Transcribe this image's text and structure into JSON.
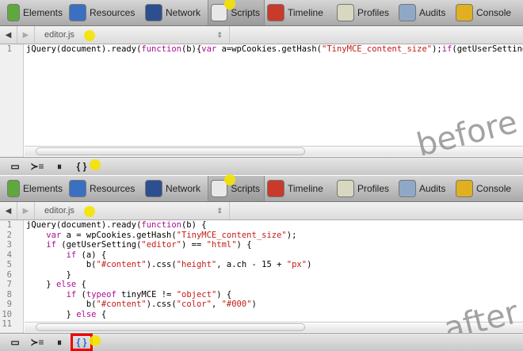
{
  "toolbar": {
    "tabs": [
      {
        "label": "Elements",
        "icon": "elements-icon",
        "color": "#5fa83b"
      },
      {
        "label": "Resources",
        "icon": "resources-icon",
        "color": "#3b6fc1"
      },
      {
        "label": "Network",
        "icon": "network-icon",
        "color": "#2d4f8f"
      },
      {
        "label": "Scripts",
        "icon": "scripts-icon",
        "color": "#e8e8e8",
        "selected": true
      },
      {
        "label": "Timeline",
        "icon": "timeline-icon",
        "color": "#c83a2a"
      },
      {
        "label": "Profiles",
        "icon": "profiles-icon",
        "color": "#d8d8c0"
      },
      {
        "label": "Audits",
        "icon": "audits-icon",
        "color": "#8fa8c8"
      },
      {
        "label": "Console",
        "icon": "console-icon",
        "color": "#e0b020"
      }
    ]
  },
  "nav": {
    "back": "◀",
    "forward": "▶",
    "file": "editor.js",
    "updown": "⇕"
  },
  "before": {
    "watermark": "before",
    "line_numbers": [
      "1"
    ],
    "lines": [
      [
        {
          "t": "jQuery(document).ready("
        },
        {
          "t": "function",
          "c": "kw"
        },
        {
          "t": "(b){"
        },
        {
          "t": "var",
          "c": "kw"
        },
        {
          "t": " a=wpCookies.getHash("
        },
        {
          "t": "\"TinyMCE_content_size\"",
          "c": "str"
        },
        {
          "t": ");"
        },
        {
          "t": "if",
          "c": "kw"
        },
        {
          "t": "(getUserSetting("
        }
      ]
    ]
  },
  "after": {
    "watermark": "after",
    "line_numbers": [
      "1",
      "2",
      "3",
      "4",
      "5",
      "6",
      "7",
      "8",
      "9",
      "10",
      "11"
    ],
    "lines": [
      [
        {
          "t": "jQuery(document).ready("
        },
        {
          "t": "function",
          "c": "kw"
        },
        {
          "t": "(b) {"
        }
      ],
      [
        {
          "t": "    "
        },
        {
          "t": "var",
          "c": "kw"
        },
        {
          "t": " a = wpCookies.getHash("
        },
        {
          "t": "\"TinyMCE_content_size\"",
          "c": "str"
        },
        {
          "t": ");"
        }
      ],
      [
        {
          "t": "    "
        },
        {
          "t": "if",
          "c": "kw"
        },
        {
          "t": " (getUserSetting("
        },
        {
          "t": "\"editor\"",
          "c": "str"
        },
        {
          "t": ") == "
        },
        {
          "t": "\"html\"",
          "c": "str"
        },
        {
          "t": ") {"
        }
      ],
      [
        {
          "t": "        "
        },
        {
          "t": "if",
          "c": "kw"
        },
        {
          "t": " (a) {"
        }
      ],
      [
        {
          "t": "            b("
        },
        {
          "t": "\"#content\"",
          "c": "str"
        },
        {
          "t": ").css("
        },
        {
          "t": "\"height\"",
          "c": "str"
        },
        {
          "t": ", a.ch - 15 + "
        },
        {
          "t": "\"px\"",
          "c": "str"
        },
        {
          "t": ")"
        }
      ],
      [
        {
          "t": "        }"
        }
      ],
      [
        {
          "t": "    } "
        },
        {
          "t": "else",
          "c": "kw"
        },
        {
          "t": " {"
        }
      ],
      [
        {
          "t": "        "
        },
        {
          "t": "if",
          "c": "kw"
        },
        {
          "t": " ("
        },
        {
          "t": "typeof",
          "c": "kw"
        },
        {
          "t": " tinyMCE != "
        },
        {
          "t": "\"object\"",
          "c": "str"
        },
        {
          "t": ") {"
        }
      ],
      [
        {
          "t": "            b("
        },
        {
          "t": "\"#content\"",
          "c": "str"
        },
        {
          "t": ").css("
        },
        {
          "t": "\"color\"",
          "c": "str"
        },
        {
          "t": ", "
        },
        {
          "t": "\"#000\"",
          "c": "str"
        },
        {
          "t": ")"
        }
      ],
      [
        {
          "t": "        } "
        },
        {
          "t": "else",
          "c": "kw"
        },
        {
          "t": " {"
        }
      ],
      []
    ]
  },
  "statusbar": {
    "buttons": [
      {
        "label": "▭",
        "icon": "dock-icon"
      },
      {
        "label": "≻≡",
        "icon": "console-drawer-icon"
      },
      {
        "label": "⏸",
        "icon": "pause-on-exceptions-icon"
      },
      {
        "label": "{ }",
        "icon": "pretty-print-icon"
      }
    ]
  }
}
